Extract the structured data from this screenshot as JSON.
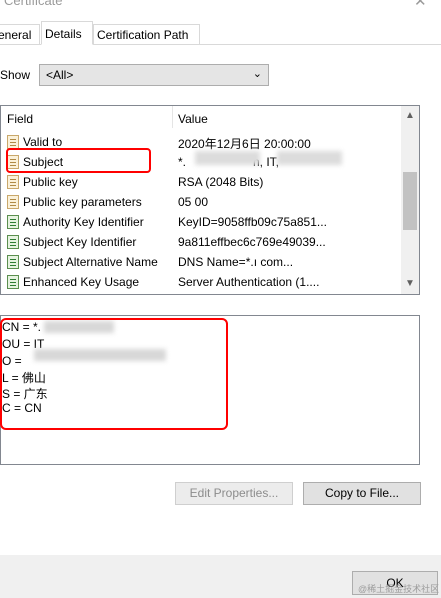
{
  "window": {
    "title": "Certificate",
    "close_glyph": "✕"
  },
  "tabs": [
    {
      "label": "eneral"
    },
    {
      "label": "Details"
    },
    {
      "label": "Certification Path"
    }
  ],
  "show": {
    "label": "Show",
    "selected": "<All>"
  },
  "list": {
    "headers": {
      "field": "Field",
      "value": "Value"
    },
    "rows": [
      {
        "field": "Valid to",
        "value": "2020年12月6日 20:00:00",
        "icon": "certificate-field-icon"
      },
      {
        "field": "Subject",
        "value": "*.",
        "value_tail": "n, IT,",
        "icon": "certificate-field-icon",
        "selected": true
      },
      {
        "field": "Public key",
        "value": "RSA (2048 Bits)",
        "icon": "certificate-field-icon"
      },
      {
        "field": "Public key parameters",
        "value": "05 00",
        "icon": "certificate-field-icon"
      },
      {
        "field": "Authority Key Identifier",
        "value": "KeyID=9058ffb09c75a851...",
        "icon": "extension-field-icon"
      },
      {
        "field": "Subject Key Identifier",
        "value": "9a811effbec6c769e49039...",
        "icon": "extension-field-icon"
      },
      {
        "field": "Subject Alternative Name",
        "value": "DNS Name=*.ı          com...",
        "icon": "extension-field-icon"
      },
      {
        "field": "Enhanced Key Usage",
        "value": "Server Authentication (1....",
        "icon": "extension-field-icon"
      }
    ]
  },
  "detail_lines": [
    "CN = *.",
    "OU = IT",
    "O =",
    "L = 佛山",
    "S = 广东",
    "C = CN"
  ],
  "buttons": {
    "edit_properties": "Edit Properties...",
    "copy_to_file": "Copy to File...",
    "ok": "OK"
  },
  "watermark": "@稀土掘金技术社区",
  "colors": {
    "highlight": "#ff0000"
  }
}
